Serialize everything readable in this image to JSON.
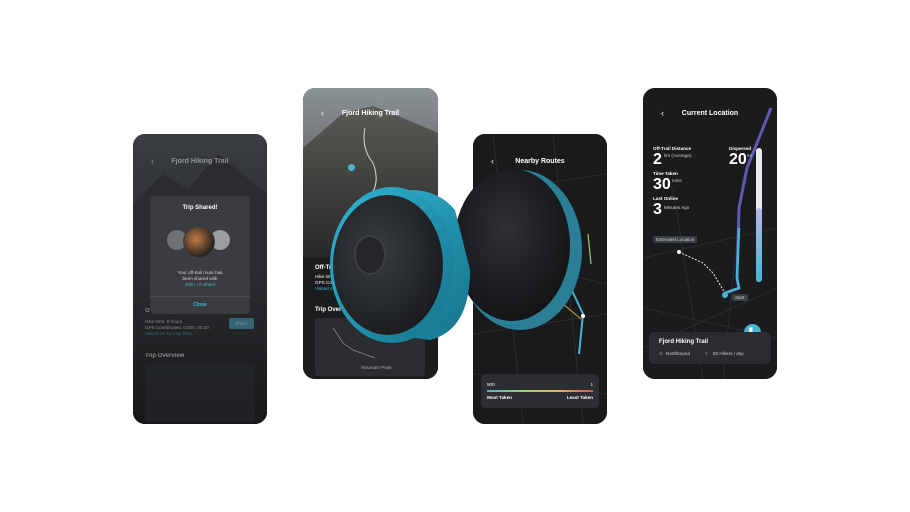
{
  "screen1": {
    "title": "Fjord Hiking Trail",
    "modal": {
      "title": "Trip Shared!",
      "message_line1": "Your off-trail route has",
      "message_line2": "been shared with",
      "shared_with": "John +2 others",
      "close_label": "Close"
    },
    "info": {
      "hike_time": "Hike time: 5 hours",
      "gps": "GPS Coordinates: 0.000, 00.00",
      "visited": "Visited on 12 Aug 2021",
      "share_label": "Share"
    },
    "trip_overview": "Trip Overview"
  },
  "screen2": {
    "title": "Fjord Hiking Trail",
    "section_prefix": "Off-Tr",
    "line1": "Hike tim",
    "line2": "GPS Coo",
    "line3": "Visited o",
    "trip_overview": "Trip Overv",
    "map_label": "Mountain Peak"
  },
  "screen3": {
    "title": "Nearby Routes",
    "scale_min": "500",
    "scale_max": "1",
    "most_taken": "Most Taken",
    "least_taken": "Least Taken"
  },
  "screen4": {
    "title": "Current Location",
    "distance_label": "Off-Trail Distance",
    "distance_value": "2",
    "distance_unit": "km (Average)",
    "dispersed_label": "Dispersed",
    "dispersed_value": "20",
    "dispersed_unit": "mi",
    "time_label": "Time Taken",
    "time_value": "30",
    "time_unit": "mins",
    "online_label": "Last Online",
    "online_value": "3",
    "online_unit": "Minutes Ago",
    "estimated_tag": "Estimated Location",
    "start_tag": "Start",
    "trail_name": "Fjord Hiking Trail",
    "direction": "Northbound",
    "hikers": "50 Hikers / day"
  },
  "colors": {
    "accent": "#46b5d3",
    "phone_bg": "#1b1c1e",
    "route_purple": "#7a6fd6"
  }
}
